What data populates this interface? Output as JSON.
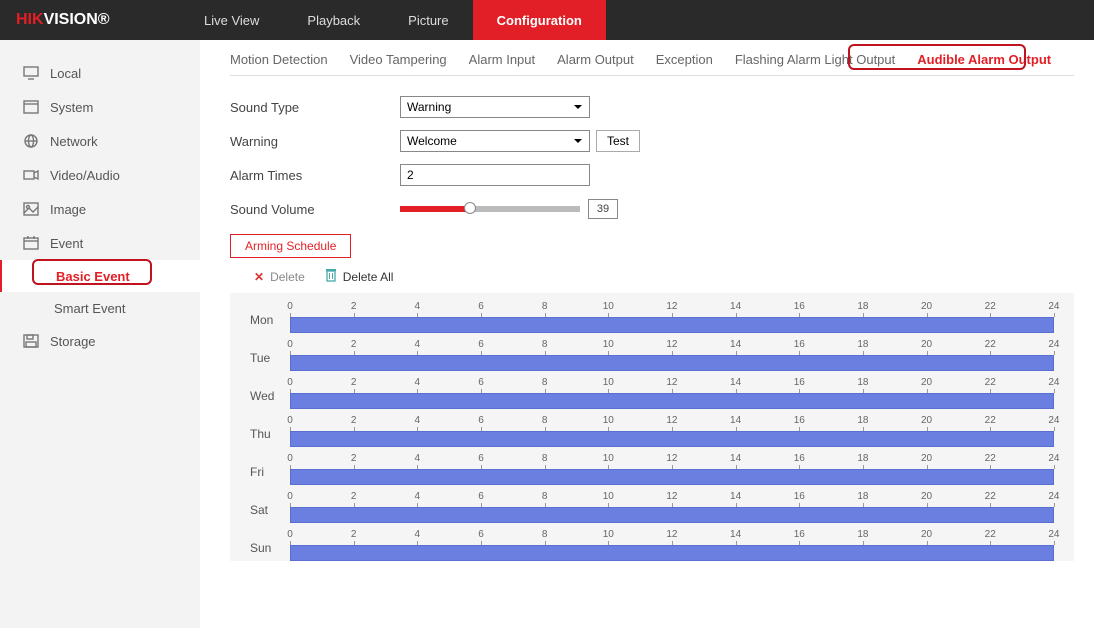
{
  "brand": {
    "prefix": "HIK",
    "suffix": "VISION",
    "reg": "®"
  },
  "topnav": [
    "Live View",
    "Playback",
    "Picture",
    "Configuration"
  ],
  "topnav_active": 3,
  "sidebar": [
    {
      "label": "Local",
      "icon": "monitor-icon"
    },
    {
      "label": "System",
      "icon": "window-icon"
    },
    {
      "label": "Network",
      "icon": "globe-icon"
    },
    {
      "label": "Video/Audio",
      "icon": "camera-icon"
    },
    {
      "label": "Image",
      "icon": "image-icon"
    },
    {
      "label": "Event",
      "icon": "calendar-icon",
      "children": [
        {
          "label": "Basic Event",
          "active": true
        },
        {
          "label": "Smart Event",
          "active": false
        }
      ]
    },
    {
      "label": "Storage",
      "icon": "save-icon"
    }
  ],
  "subtabs": [
    "Motion Detection",
    "Video Tampering",
    "Alarm Input",
    "Alarm Output",
    "Exception",
    "Flashing Alarm Light Output",
    "Audible Alarm Output"
  ],
  "subtab_active": 6,
  "form": {
    "sound_type_label": "Sound Type",
    "sound_type_value": "Warning",
    "warning_label": "Warning",
    "warning_value": "Welcome",
    "test_label": "Test",
    "alarm_times_label": "Alarm Times",
    "alarm_times_value": "2",
    "sound_volume_label": "Sound Volume",
    "sound_volume_value": "39"
  },
  "arming_tab": "Arming Schedule",
  "actions": {
    "delete": "Delete",
    "delete_all": "Delete All"
  },
  "schedule": {
    "days": [
      "Mon",
      "Tue",
      "Wed",
      "Thu",
      "Fri",
      "Sat",
      "Sun"
    ],
    "ticks": [
      "0",
      "2",
      "4",
      "6",
      "8",
      "10",
      "12",
      "14",
      "16",
      "18",
      "20",
      "22",
      "24"
    ]
  }
}
